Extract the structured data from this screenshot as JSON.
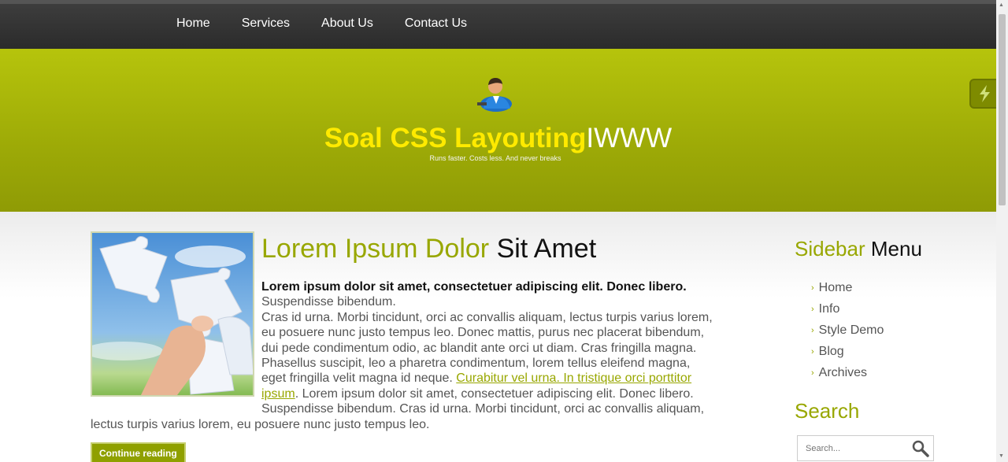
{
  "nav": {
    "items": [
      "Home",
      "Services",
      "About Us",
      "Contact Us"
    ]
  },
  "header": {
    "title_highlight": "Soal CSS Layouting",
    "title_rest": "IWWW",
    "tagline": "Runs faster. Costs less. And never breaks"
  },
  "post": {
    "title_highlight": "Lorem Ipsum Dolor",
    "title_rest": "Sit Amet",
    "intro_bold": "Lorem ipsum dolor sit amet, consectetuer adipiscing elit. Donec libero.",
    "text1": "Suspendisse bibendum.",
    "text2": "Cras id urna. Morbi tincidunt, orci ac convallis aliquam, lectus turpis varius lorem, eu posuere nunc justo tempus leo. Donec mattis, purus nec placerat bibendum, dui pede condimentum odio, ac blandit ante orci ut diam. Cras fringilla magna. Phasellus suscipit, leo a pharetra condimentum, lorem tellus eleifend magna, eget fringilla velit magna id neque.",
    "link_text": "Curabitur vel urna. In tristique orci porttitor ipsum",
    "text3": ". Lorem ipsum dolor sit amet, consectetuer adipiscing elit. Donec libero. Suspendisse bibendum. Cras id urna. Morbi tincidunt, orci ac convallis aliquam, lectus turpis varius lorem, eu posuere nunc justo tempus leo.",
    "button_label": "Continue reading"
  },
  "sidebar": {
    "title_highlight": "Sidebar",
    "title_rest": "Menu",
    "menu": [
      "Home",
      "Info",
      "Style Demo",
      "Blog",
      "Archives"
    ],
    "search_title": "Search",
    "search_placeholder": "Search..."
  },
  "colors": {
    "accent": "#98a700",
    "title_yellow": "#ffea00",
    "nav_bg": "#333333"
  }
}
